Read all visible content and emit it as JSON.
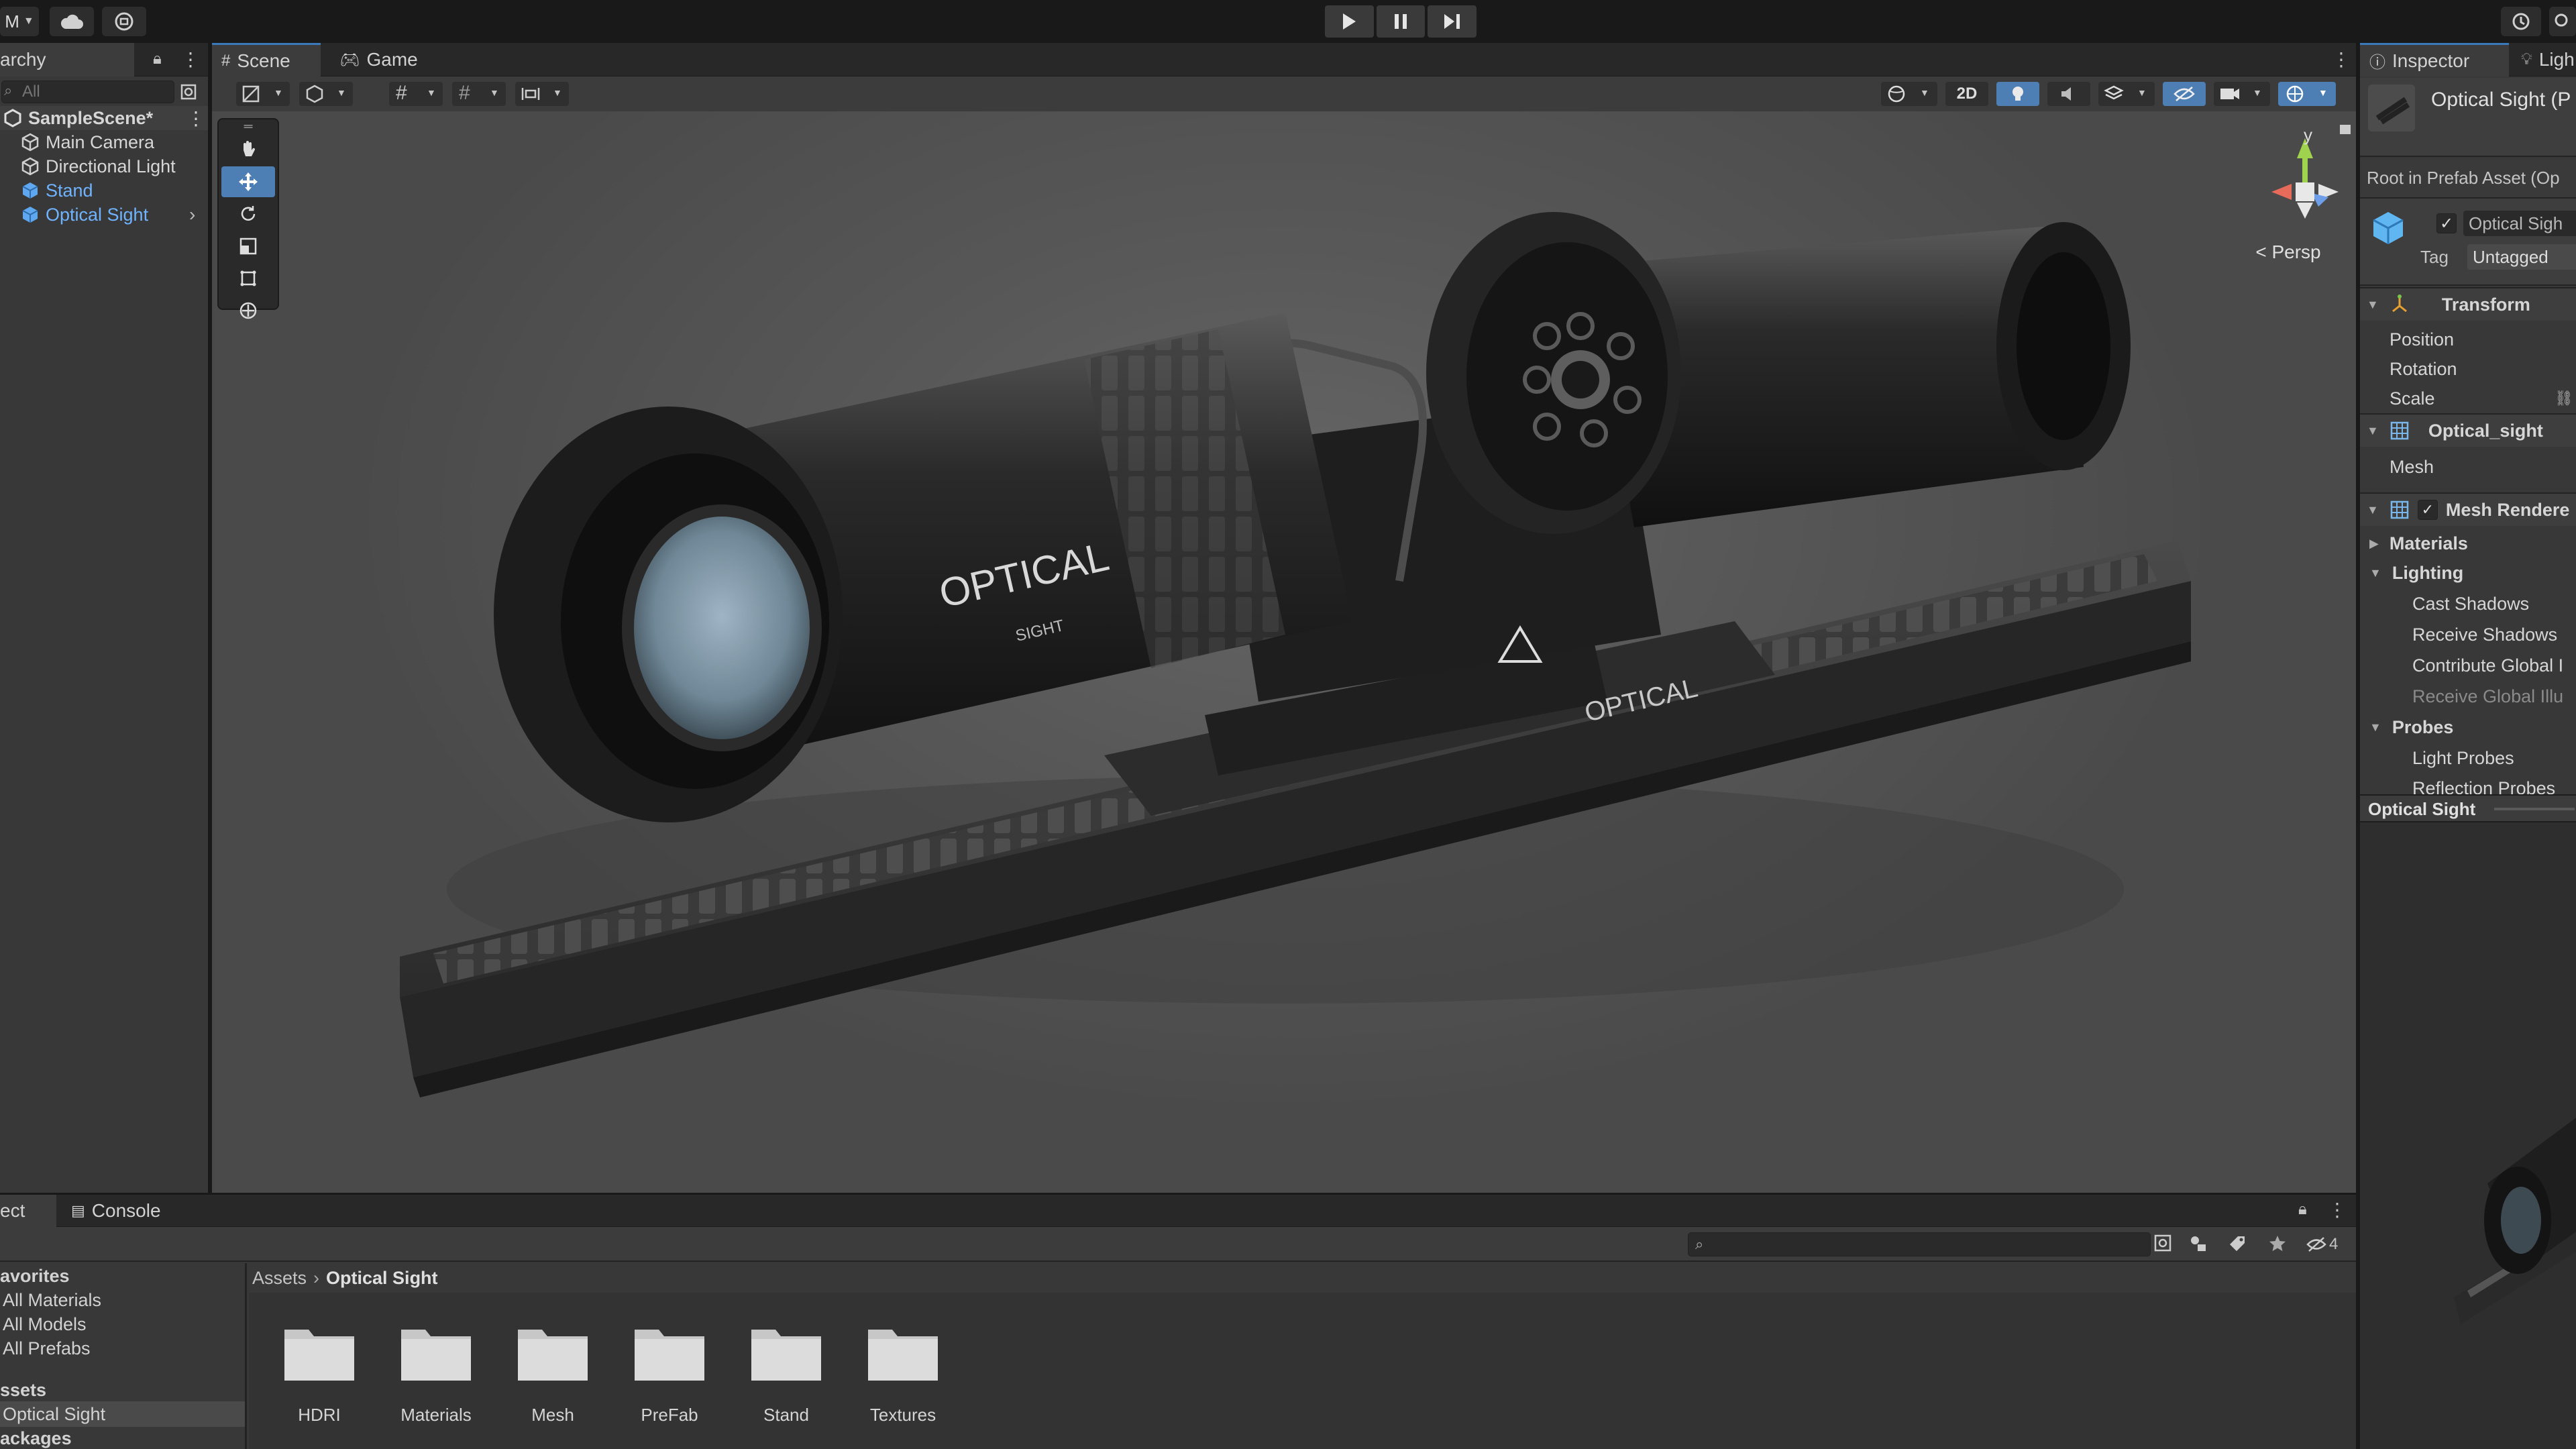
{
  "toolbar": {
    "account_label": "M",
    "play_icon": "play-icon",
    "pause_icon": "pause-icon",
    "step_icon": "step-icon"
  },
  "hierarchy": {
    "tab_label": "archy",
    "search_placeholder": "All",
    "scene_name": "SampleScene*",
    "items": [
      {
        "label": "Main Camera",
        "selected": false
      },
      {
        "label": "Directional Light",
        "selected": false
      },
      {
        "label": "Stand",
        "selected": true
      },
      {
        "label": "Optical Sight",
        "selected": true
      }
    ]
  },
  "scene": {
    "tabs": [
      {
        "label": "Scene"
      },
      {
        "label": "Game"
      }
    ],
    "toggle_2d": "2D",
    "gizmo_axis_y": "y",
    "projection": "Persp",
    "model_text_main": "OPTICAL",
    "model_text_sub": "SIGHT"
  },
  "inspector": {
    "tabs": [
      {
        "label": "Inspector"
      },
      {
        "label": "Ligh"
      }
    ],
    "object_title": "Optical Sight (P",
    "prefab_root": "Root in Prefab Asset (Op",
    "object_name": "Optical Sigh",
    "tag_label": "Tag",
    "tag_value": "Untagged",
    "transform_title": "Transform",
    "transform_fields": [
      "Position",
      "Rotation",
      "Scale"
    ],
    "mesh_filter_title": "Optical_sight",
    "mesh_label": "Mesh",
    "renderer_title": "Mesh Rendere",
    "materials_label": "Materials",
    "lighting_label": "Lighting",
    "lighting_fields": [
      "Cast Shadows",
      "Receive Shadows",
      "Contribute Global I",
      "Receive Global Illu"
    ],
    "probes_label": "Probes",
    "probes_fields": [
      "Light Probes",
      "Reflection Probes"
    ],
    "preview_title": "Optical Sight"
  },
  "project": {
    "tabs": [
      {
        "label": "ect"
      },
      {
        "label": "Console"
      }
    ],
    "favorites_header": "avorites",
    "favorites": [
      "All Materials",
      "All Models",
      "All Prefabs"
    ],
    "assets_header": "ssets",
    "assets_selected": "Optical Sight",
    "packages_header": "ackages",
    "breadcrumb": [
      "Assets",
      "Optical Sight"
    ],
    "hidden_count": "4",
    "folders": [
      "HDRI",
      "Materials",
      "Mesh",
      "PreFab",
      "Stand",
      "Textures"
    ]
  },
  "colors": {
    "accent": "#3a79bb",
    "selected_text": "#6fb3ff",
    "panel_bg": "#383838",
    "viewport_bg": "#595959"
  }
}
